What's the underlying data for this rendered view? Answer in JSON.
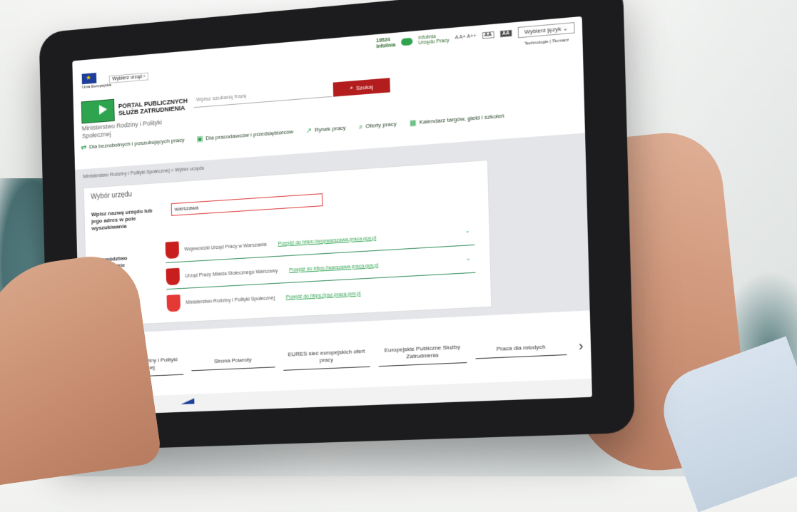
{
  "utility": {
    "phone_number": "19524",
    "phone_caption": "Infolinia",
    "contact_line1": "Infolinia",
    "contact_line2": "Urzędu Pracy",
    "font_sizes": "A A+ A++",
    "contrast1": "AA",
    "contrast2": "AA",
    "language_button": "Wybierz język",
    "links": "Technologie | Tłumacz"
  },
  "header": {
    "eu_label": "Unia Europejska",
    "choose_office": "Wybierz urząd",
    "logo_text_line1": "PORTAL PUBLICZNYCH",
    "logo_text_line2": "SŁUŻB ZATRUDNIENIA",
    "ministry": "Ministerstwo Rodziny i Polityki Społecznej",
    "search_placeholder": "Wpisz szukaną frazę",
    "search_button": "Szukaj"
  },
  "nav": [
    {
      "label": "Dla bezrobotnych i poszukujących pracy",
      "icon": "signpost-icon"
    },
    {
      "label": "Dla pracodawców i przedsiębiorców",
      "icon": "briefcase-icon"
    },
    {
      "label": "Rynek pracy",
      "icon": "chart-icon"
    },
    {
      "label": "Oferty pracy",
      "icon": "search-icon"
    },
    {
      "label": "Kalendarz targów, giełd i szkoleń",
      "icon": "calendar-icon"
    }
  ],
  "breadcrumb": "Ministerstwo Rodziny i Polityki Społecznej  >  Wybór urzędu",
  "panel": {
    "title": "Wybór urzędu",
    "input_label": "Wpisz nazwę urzędu lub jego adres w pole wyszukiwania",
    "input_value": "warszawa",
    "region_label": "Województwo mazowieckie",
    "results": [
      {
        "name": "Wojewódzki Urząd Pracy w Warszawie",
        "link": "Przejdź do https://wupwarszawa.praca.gov.pl"
      },
      {
        "name": "Urząd Pracy Miasta Stołecznego Warszawy",
        "link": "Przejdź do https://warszawa.praca.gov.pl"
      },
      {
        "name": "Ministerstwo Rodziny i Polityki Społecznej",
        "link": "Przejdź do https://psz.praca.gov.pl"
      }
    ]
  },
  "carousel": [
    "Ministerstwo Rodziny i Polityki Społecznej",
    "Strona Powroty",
    "EURES sieć europejskich ofert pracy",
    "Europejskie Publiczne Służby Zatrudnienia",
    "Praca dla młodych"
  ],
  "colors": {
    "brand_green": "#2ea44f",
    "search_red": "#b31d1d",
    "input_border": "#dd3333"
  }
}
